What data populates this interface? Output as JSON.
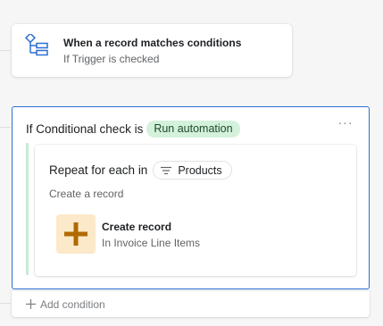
{
  "trigger": {
    "title": "When a record matches conditions",
    "subtitle": "If Trigger is checked",
    "icon": "hierarchy-icon"
  },
  "condition": {
    "prefix": "If Conditional check is",
    "pill_label": "Run automation",
    "more_label": "···",
    "pill_color": "#d4f1dc"
  },
  "loop": {
    "prefix": "Repeat for each in",
    "field_label": "Products",
    "subtitle": "Create a record"
  },
  "action": {
    "title": "Create record",
    "subtitle": "In Invoice Line Items",
    "icon": "plus-icon",
    "icon_color": "#b06a00",
    "icon_bg": "#fce9c9"
  },
  "footer": {
    "add_condition_label": "Add condition"
  },
  "colors": {
    "accent": "#2b6fd1",
    "background": "#f6f6f7"
  }
}
